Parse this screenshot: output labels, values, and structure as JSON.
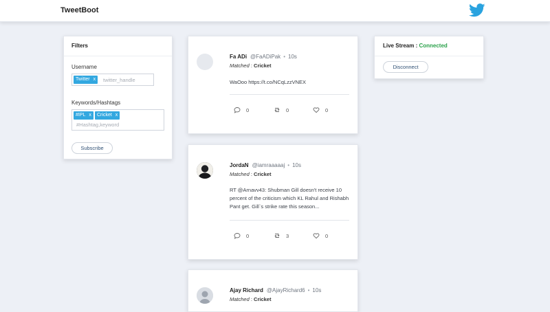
{
  "app": {
    "title": "TweetBoot"
  },
  "filters": {
    "title": "Filters",
    "username_label": "Username",
    "username_tags": [
      {
        "label": "Twitter",
        "remove": "x"
      }
    ],
    "username_placeholder": "twitter_handle",
    "keywords_label": "Keywords/Hashtags",
    "keyword_tags": [
      {
        "label": "#IPL",
        "remove": "x"
      },
      {
        "label": "Cricket",
        "remove": "x"
      }
    ],
    "keywords_placeholder": "#Hashtag,keyword",
    "subscribe_label": "Subscribe"
  },
  "tweets": [
    {
      "name": "Fa ADi",
      "handle": "@FaADiPak",
      "time": "10s",
      "dot": "•",
      "matched_label": "Matched",
      "matched_sep": " : ",
      "matched_value": "Cricket",
      "text": "WaOoo https://t.co/NCqLzzVNEX",
      "replies": "0",
      "retweets": "0",
      "likes": "0"
    },
    {
      "name": "JordaN",
      "handle": "@iamraaaaaj",
      "time": "10s",
      "dot": "•",
      "matched_label": "Matched",
      "matched_sep": " : ",
      "matched_value": "Cricket",
      "text": "RT @Arnavv43: Shubman Gill doesn't receive 10 percent of the criticism which KL Rahul and Rishabh Pant get. Gill`s strike rate this season...",
      "replies": "0",
      "retweets": "3",
      "likes": "0"
    },
    {
      "name": "Ajay Richard",
      "handle": "@AjayRichard6",
      "time": "10s",
      "dot": "•",
      "matched_label": "Matched",
      "matched_sep": " : ",
      "matched_value": "Cricket"
    }
  ],
  "live": {
    "label": "Live Stream : ",
    "status": "Connected",
    "status_color": "#2aa14a",
    "disconnect_label": "Disconnect"
  },
  "icons": [
    "twitter-bird-icon",
    "reply-icon",
    "retweet-icon",
    "heart-icon"
  ]
}
